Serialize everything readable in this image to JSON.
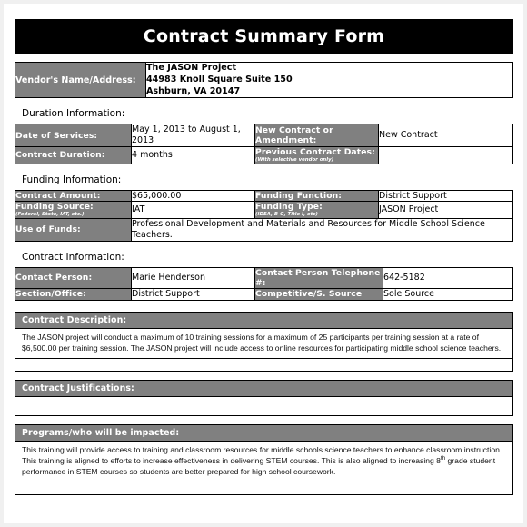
{
  "document": {
    "title": "Contract Summary Form"
  },
  "vendor": {
    "label": "Vendor's Name/Address:",
    "name": "The JASON PROJECT",
    "line1": "The JASON Project",
    "line2": "44983 Knoll Square Suite 150",
    "line3": "Ashburn, VA 20147"
  },
  "duration": {
    "heading": "Duration Information:",
    "rows": [
      {
        "label1": "Date of Services:",
        "value1": "May 1, 2013 to August 1, 2013",
        "label2": "New Contract or Amendment:",
        "label2_sub": "",
        "value2": "New Contract"
      },
      {
        "label1": "Contract Duration:",
        "value1": "4 months",
        "label2": "Previous Contract Dates:",
        "label2_sub": "(With selective vendor only)",
        "value2": ""
      }
    ]
  },
  "funding": {
    "heading": "Funding Information:",
    "rows": [
      {
        "label1": "Contract Amount:",
        "label1_sub": "",
        "value1": "$65,000.00",
        "label2": "Funding Function:",
        "label2_sub": "",
        "value2": "District Support"
      },
      {
        "label1": "Funding Source:",
        "label1_sub": "(Federal, State, IAT, etc.)",
        "value1": "IAT",
        "label2": "Funding Type:",
        "label2_sub": "(IDEA, B-G, Title I, etc)",
        "value2": "JASON Project"
      }
    ],
    "use_of_funds_label": "Use of Funds:",
    "use_of_funds_value": "Professional Development and Materials and Resources for Middle School Science Teachers."
  },
  "contact": {
    "heading": "Contract Information:",
    "rows": [
      {
        "label1": "Contact  Person:",
        "value1": "Marie Henderson",
        "label2": "Contact  Person Telephone #:",
        "value2": "642-5182"
      },
      {
        "label1": "Section/Office:",
        "value1": "District Support",
        "label2": "Competitive/S. Source",
        "value2": "Sole Source"
      }
    ]
  },
  "description": {
    "heading": "Contract Description:",
    "body": "The JASON project will conduct a maximum of 10 training sessions for a maximum of 25 participants per training session at a rate of $6,500.00 per training session.  The JASON project will include access to online resources for participating middle school science teachers."
  },
  "justifications": {
    "heading": "Contract Justifications:",
    "body": ""
  },
  "programs": {
    "heading": "Programs/who will be impacted:",
    "body_part1": "This training will provide access to training and classroom resources for middle schools science teachers to enhance classroom instruction.  This training is aligned to efforts to increase effectiveness in delivering STEM courses.  This is also aligned to increasing 8",
    "body_sup": "th",
    "body_part2": " grade student performance in STEM courses so students are better prepared for high school coursework."
  },
  "colors": {
    "title_bar": "#000000",
    "label_gray": "#808080",
    "page_background": "#ffffff",
    "text": "#000000"
  }
}
